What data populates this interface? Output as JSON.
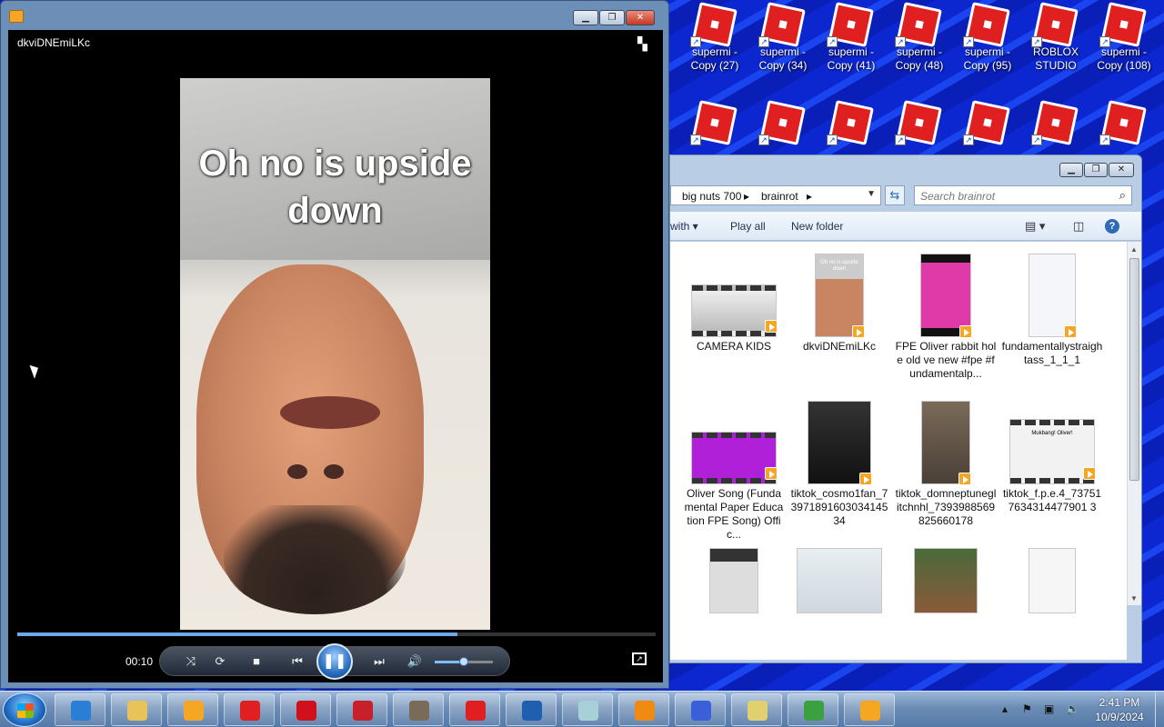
{
  "desktop": {
    "row1": [
      {
        "label": "supermi - Copy (27)"
      },
      {
        "label": "supermi - Copy (34)"
      },
      {
        "label": "supermi - Copy (41)"
      },
      {
        "label": "supermi - Copy (48)"
      },
      {
        "label": "supermi - Copy (95)"
      },
      {
        "label": "ROBLOX STUDIO"
      },
      {
        "label": "supermi - Copy (108)"
      }
    ]
  },
  "player": {
    "filename": "dkviDNEmiLKc",
    "caption": "Oh no is upside down",
    "time": "00:10",
    "progress": 0.69,
    "volume": 0.5,
    "icons": {
      "app": "media-player-icon",
      "shuffle": "shuffle-icon",
      "repeat": "repeat-icon",
      "stop": "stop-icon",
      "prev": "previous-icon",
      "play": "pause-icon",
      "next": "next-icon",
      "mute": "speaker-icon",
      "fullscreen": "fullscreen-icon",
      "layout": "switch-to-library-icon"
    }
  },
  "explorer": {
    "breadcrumbs": [
      "big nuts 700",
      "brainrot"
    ],
    "search_placeholder": "Search brainrot",
    "commands": {
      "open_with": "with",
      "play_all": "Play all",
      "new_folder": "New folder"
    },
    "files": [
      {
        "label": "CAMERA KIDS",
        "style": "film"
      },
      {
        "label": "dkviDNEmiLKc",
        "style": "portrait",
        "thumb_text": "Oh no is upside down"
      },
      {
        "label": "FPE Oliver rabbit hole old ve new #fpe #fundamentalp...",
        "style": "pink"
      },
      {
        "label": "fundamentallystraightass_1_1_1",
        "style": "white"
      },
      {
        "label": "Oliver Song (Fundamental Paper Education FPE Song) Offic...",
        "style": "magenta-film"
      },
      {
        "label": "tiktok_cosmo1fan_7397189160303414534",
        "style": "dark"
      },
      {
        "label": "tiktok_domneptuneglitchnhl_7393988569825660178",
        "style": "char"
      },
      {
        "label": "tiktok_f.p.e.4_737517634314477901 3",
        "style": "mukbang",
        "thumb_text": "Mukbang! Oliver!"
      },
      {
        "label": "",
        "style": "grey"
      },
      {
        "label": "",
        "style": "room"
      },
      {
        "label": "",
        "style": "building"
      },
      {
        "label": "",
        "style": "sketch"
      }
    ]
  },
  "taskbar": {
    "clock_time": "2:41 PM",
    "clock_date": "10/9/2024",
    "apps": [
      {
        "name": "internet-explorer-icon",
        "color": "#2a7fd4"
      },
      {
        "name": "file-explorer-icon",
        "color": "#e8c35a"
      },
      {
        "name": "media-player-icon",
        "color": "#f5a623"
      },
      {
        "name": "roblox-icon",
        "color": "#e02020"
      },
      {
        "name": "opera-icon",
        "color": "#d0101a"
      },
      {
        "name": "toolbox-icon",
        "color": "#c8202a"
      },
      {
        "name": "gimp-icon",
        "color": "#7a6a58"
      },
      {
        "name": "roblox-studio-icon",
        "color": "#e02020"
      },
      {
        "name": "browser-icon",
        "color": "#1f5fb0"
      },
      {
        "name": "notepad-icon",
        "color": "#a8d0d8"
      },
      {
        "name": "vlc-icon",
        "color": "#f08a10"
      },
      {
        "name": "bird-icon",
        "color": "#3a5fd8"
      },
      {
        "name": "ruler-tool-icon",
        "color": "#e0d070"
      },
      {
        "name": "users-icon",
        "color": "#3aa040"
      },
      {
        "name": "media-player-pinned-icon",
        "color": "#f5a623"
      }
    ]
  }
}
